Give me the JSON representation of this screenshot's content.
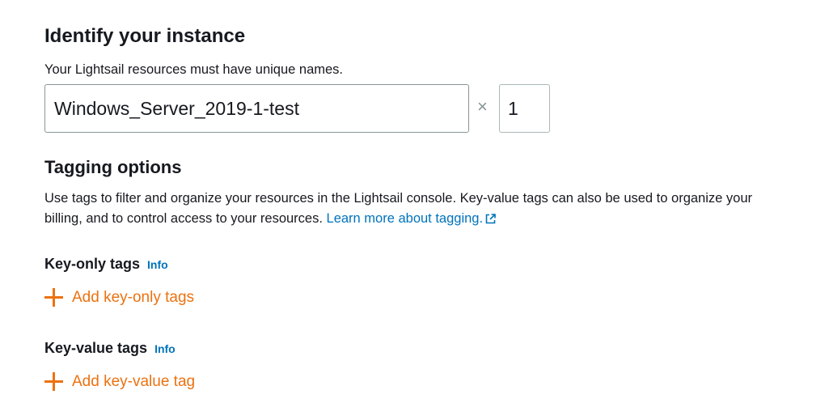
{
  "identify": {
    "heading": "Identify your instance",
    "description": "Your Lightsail resources must have unique names.",
    "instance_name_value": "Windows_Server_2019-1-test",
    "multiplier_symbol": "×",
    "instance_count_value": "1"
  },
  "tagging": {
    "heading": "Tagging options",
    "description": "Use tags to filter and organize your resources in the Lightsail console. Key-value tags can also be used to organize your billing, and to control access to your resources.",
    "learn_more_link": "Learn more about tagging.",
    "key_only": {
      "heading": "Key-only tags",
      "info_label": "Info",
      "add_label": "Add key-only tags"
    },
    "key_value": {
      "heading": "Key-value tags",
      "info_label": "Info",
      "add_label": "Add key-value tag"
    }
  },
  "colors": {
    "link": "#0073bb",
    "action": "#ec7211",
    "text": "#16191f",
    "input_border": "#879596"
  },
  "icons": {
    "external_link": "external-link-icon",
    "add": "plus-icon"
  }
}
